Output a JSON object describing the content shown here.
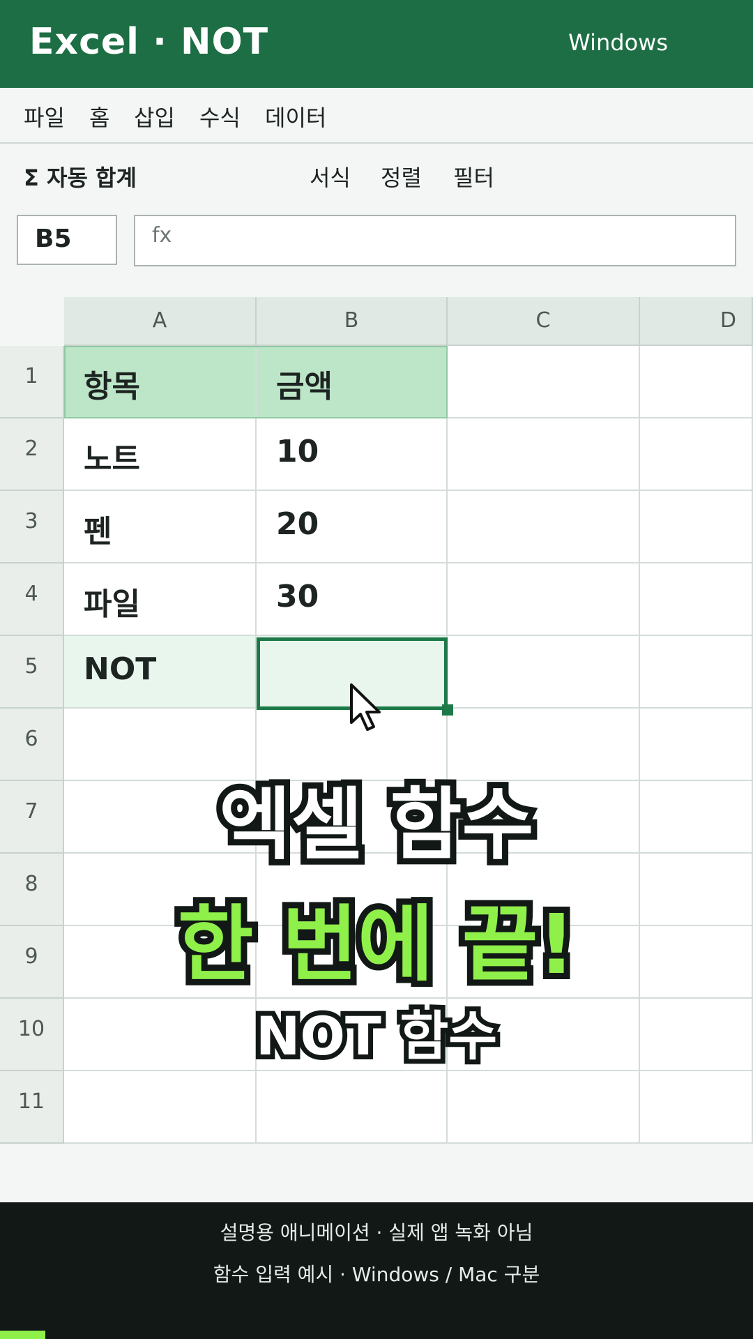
{
  "window": {
    "title": "Excel · NOT",
    "os_label": "Windows"
  },
  "menu": [
    "파일",
    "홈",
    "삽입",
    "수식",
    "데이터"
  ],
  "ribbon": {
    "autosum": "Σ 자동 합계",
    "format": "서식",
    "sort": "정렬",
    "filter": "필터"
  },
  "name_box": "B5",
  "formula_bar": {
    "placeholder": "fx"
  },
  "sheet": {
    "columns": [
      "A",
      "B",
      "C",
      "D"
    ],
    "rows": [
      "1",
      "2",
      "3",
      "4",
      "5",
      "6",
      "7",
      "8",
      "9",
      "10",
      "11"
    ],
    "cells": {
      "A1": "항목",
      "B1": "금액",
      "A2": "노트",
      "B2": "10",
      "A3": "펜",
      "B3": "20",
      "A4": "파일",
      "B4": "30",
      "A5": "NOT",
      "B5": ""
    }
  },
  "overlay": {
    "line1": "엑셀 함수",
    "line2": "한 번에 끝!",
    "line3": "NOT 함수"
  },
  "footer": {
    "line1": "설명용 애니메이션 · 실제 앱 녹화 아님",
    "line2": "함수 입력 예시 · Windows / Mac 구분"
  },
  "colors": {
    "accent": "#1d6e45",
    "highlight": "#8ff04a",
    "header_fill": "#bde6c9"
  },
  "progress_fraction": 0.06
}
